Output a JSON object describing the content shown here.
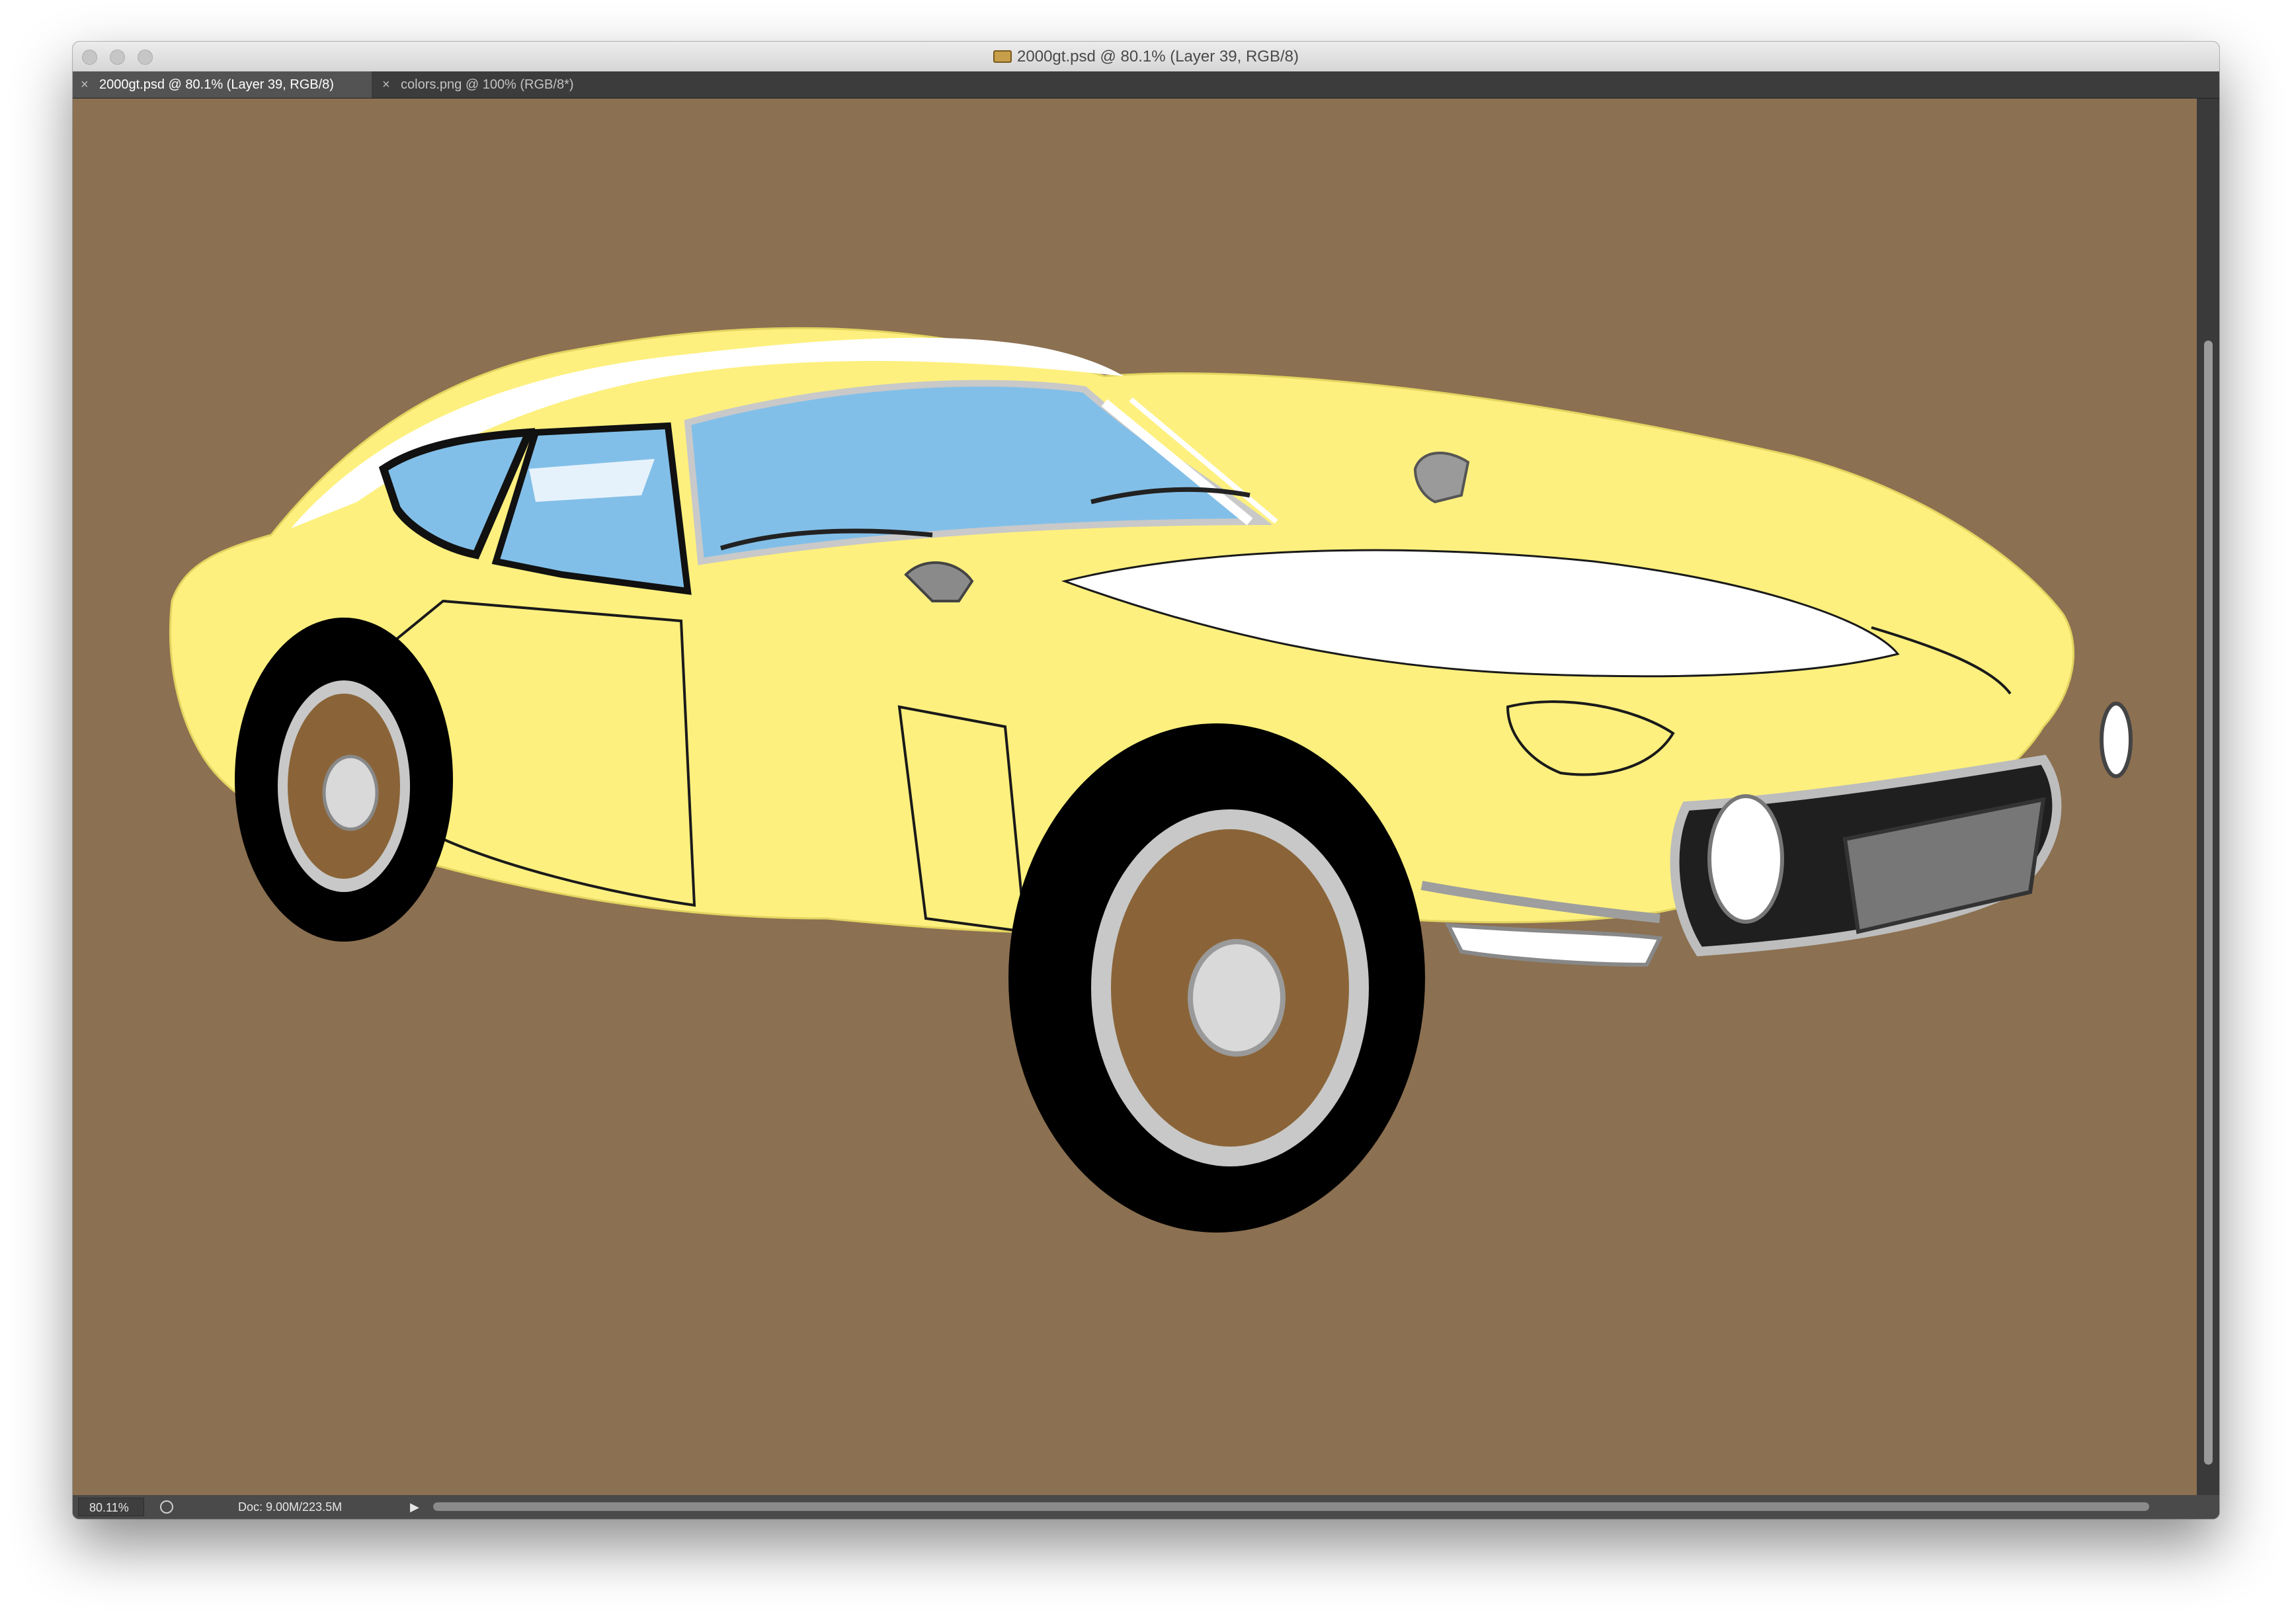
{
  "window": {
    "title": "2000gt.psd @ 80.1% (Layer 39, RGB/8)"
  },
  "tabs": [
    {
      "label": "2000gt.psd @ 80.1% (Layer 39, RGB/8)",
      "active": true,
      "close": "×"
    },
    {
      "label": "colors.png @ 100% (RGB/8*)",
      "active": false,
      "close": "×"
    }
  ],
  "status": {
    "zoom": "80.11%",
    "doc_info": "Doc: 9.00M/223.5M",
    "menu_arrow": "▶"
  },
  "colors": {
    "canvas_background": "#8b7051",
    "car_body": "#fdf07e",
    "glass": "#82bfe8",
    "tire": "#000000",
    "wheel_hub": "#8a6438"
  },
  "artwork": {
    "subject": "yellow sports coupe illustration"
  }
}
